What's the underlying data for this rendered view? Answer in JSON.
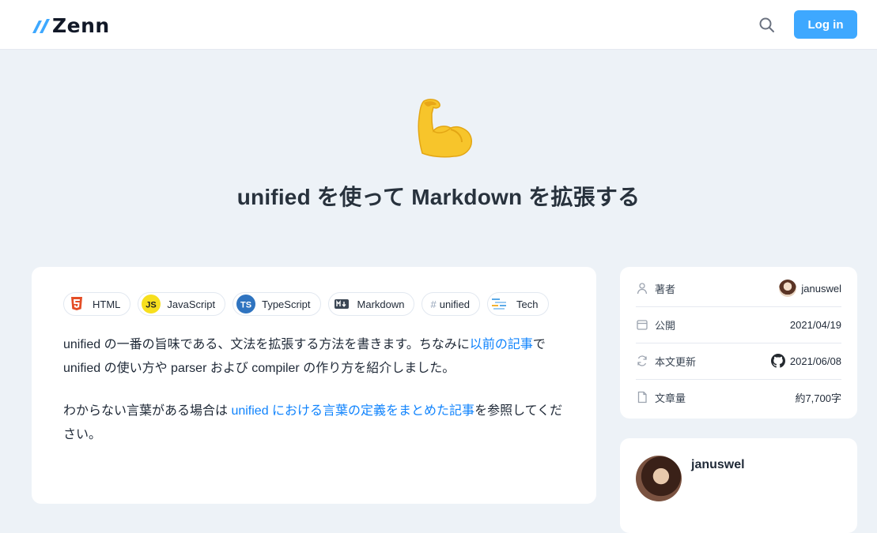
{
  "header": {
    "logo_text": "Zenn",
    "login_label": "Log in",
    "brand_color": "#3ea8ff"
  },
  "hero": {
    "emoji_icon": "flexed-biceps-icon",
    "title": "unified を使って Markdown を拡張する"
  },
  "topics": [
    {
      "label": "HTML",
      "icon": "html5-icon"
    },
    {
      "label": "JavaScript",
      "icon": "js-icon"
    },
    {
      "label": "TypeScript",
      "icon": "ts-icon"
    },
    {
      "label": "Markdown",
      "icon": "markdown-icon"
    },
    {
      "label": "unified",
      "icon": "hash-icon"
    },
    {
      "label": "Tech",
      "icon": "tech-icon"
    }
  ],
  "body": {
    "p1_before": "unified の一番の旨味である、文法を拡張する方法を書きます。ちなみに",
    "p1_link": "以前の記事",
    "p1_after": "で unified の使い方や parser および compiler の作り方を紹介しました。",
    "p2_before": "わからない言葉がある場合は ",
    "p2_link": "unified における言葉の定義をまとめた記事",
    "p2_after": "を参照してください。"
  },
  "info": {
    "author_label": "著者",
    "author_value": "januswel",
    "published_label": "公開",
    "published_value": "2021/04/19",
    "updated_label": "本文更新",
    "updated_value": "2021/06/08",
    "length_label": "文章量",
    "length_value": "約7,700字"
  },
  "author_card": {
    "name": "januswel"
  }
}
